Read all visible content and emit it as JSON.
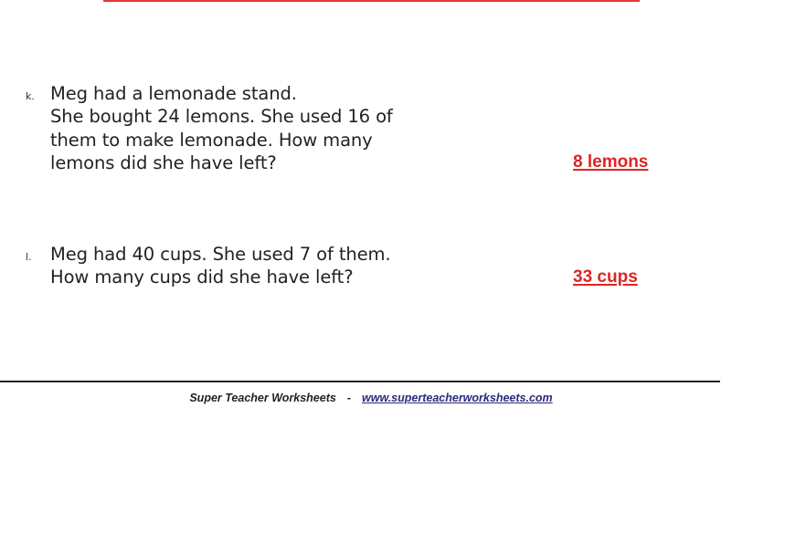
{
  "problems": [
    {
      "letter": "k.",
      "lines": [
        "Meg had a lemonade stand.",
        "She bought 24 lemons.  She used 16 of",
        "them to make lemonade.  How many",
        "lemons did she have left?"
      ],
      "answer": "8 lemons"
    },
    {
      "letter": "l.",
      "lines": [
        "Meg had 40 cups.  She used 7 of them.",
        "How many cups did she have left?"
      ],
      "answer": "33 cups"
    }
  ],
  "footer": {
    "brand": "Super Teacher Worksheets",
    "separator": "-",
    "website": "www.superteacherworksheets.com"
  },
  "colors": {
    "answer": "#e02424",
    "link": "#2a2a7a",
    "top_rule": "#e8343a"
  }
}
